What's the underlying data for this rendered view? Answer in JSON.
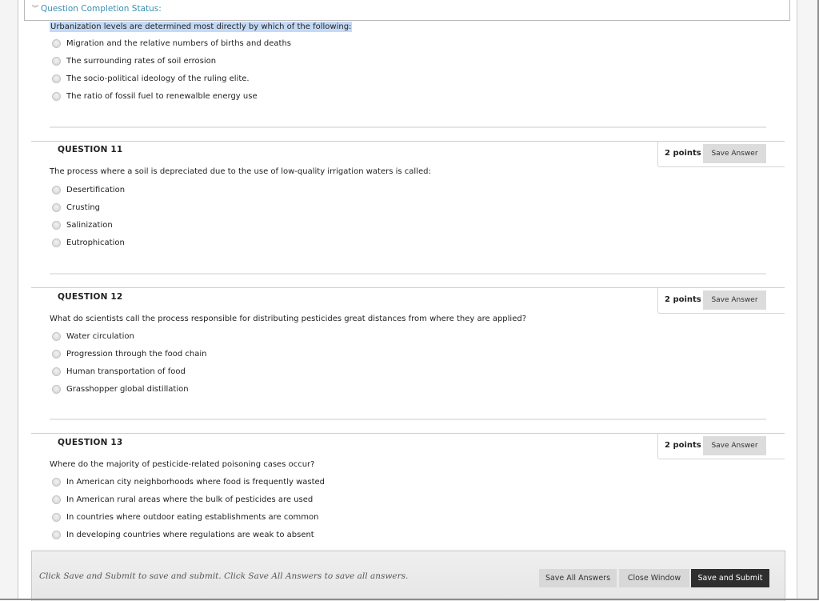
{
  "status": {
    "label": "Question Completion Status:",
    "chevron_icon": "double-chevron-down-icon"
  },
  "question10": {
    "text": "Urbanization levels are determined most directly by which of the following:",
    "options": [
      "Migration and the relative numbers of births and deaths",
      "The surrounding rates of soil errosion",
      "The socio-political ideology of the ruling elite.",
      "The ratio of fossil fuel to renewalble energy use"
    ]
  },
  "questions": [
    {
      "title": "QUESTION 11",
      "points": "2 points",
      "save_label": "Save Answer",
      "text": "The process where a soil is depreciated due to the use of low-quality irrigation waters is called:",
      "options": [
        "Desertification",
        "Crusting",
        "Salinization",
        "Eutrophication"
      ]
    },
    {
      "title": "QUESTION 12",
      "points": "2 points",
      "save_label": "Save Answer",
      "text": "What do scientists call the process responsible for distributing pesticides great distances from where they are applied?",
      "options": [
        "Water circulation",
        "Progression through the food chain",
        "Human transportation of food",
        "Grasshopper global distillation"
      ]
    },
    {
      "title": "QUESTION 13",
      "points": "2 points",
      "save_label": "Save Answer",
      "text": "Where do the majority of pesticide-related poisoning cases occur?",
      "options": [
        "In American city neighborhoods where food is frequently wasted",
        "In American rural areas where the bulk of pesticides are used",
        "In countries where outdoor eating establishments are common",
        "In developing countries where regulations are weak to absent"
      ]
    }
  ],
  "footer": {
    "note": "Click Save and Submit to save and submit. Click Save All Answers to save all answers.",
    "save_all_label": "Save All Answers",
    "close_label": "Close Window",
    "submit_label": "Save and Submit"
  },
  "colors": {
    "link": "#3a8fb2",
    "highlight": "#c4d9f5",
    "primary_button": "#2e2e2e",
    "secondary_button": "#d8d8d8"
  }
}
